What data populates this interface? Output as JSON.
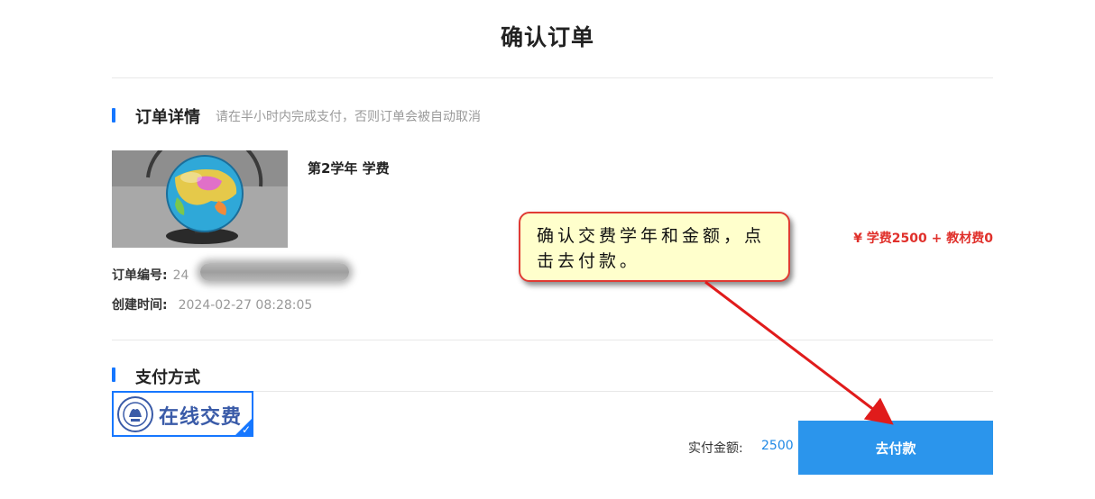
{
  "page": {
    "title": "确认订单"
  },
  "order_section": {
    "title": "订单详情",
    "hint": "请在半小时内完成支付，否则订单会被自动取消"
  },
  "product": {
    "image_icon": "globe-photo",
    "name": "第2学年 学费",
    "price_line": "¥  学费2500 + 教材费0"
  },
  "order_info": {
    "number_label": "订单编号:",
    "number_value": "24",
    "created_label": "创建时间:",
    "created_value": "2024-02-27 08:28:05"
  },
  "payment_section": {
    "title": "支付方式",
    "method_label": "在线交费",
    "method_icon": "university-seal-icon",
    "selected": true,
    "accent_color": "#1677ff"
  },
  "footer": {
    "amount_label": "实付金额:",
    "amount_value": "2500",
    "pay_button_label": "去付款",
    "button_color": "#2b95ec"
  },
  "annotation": {
    "text": "确认交费学年和金额，点击去付款。",
    "border_color": "#e03b34",
    "fill_color": "#ffffcc"
  }
}
